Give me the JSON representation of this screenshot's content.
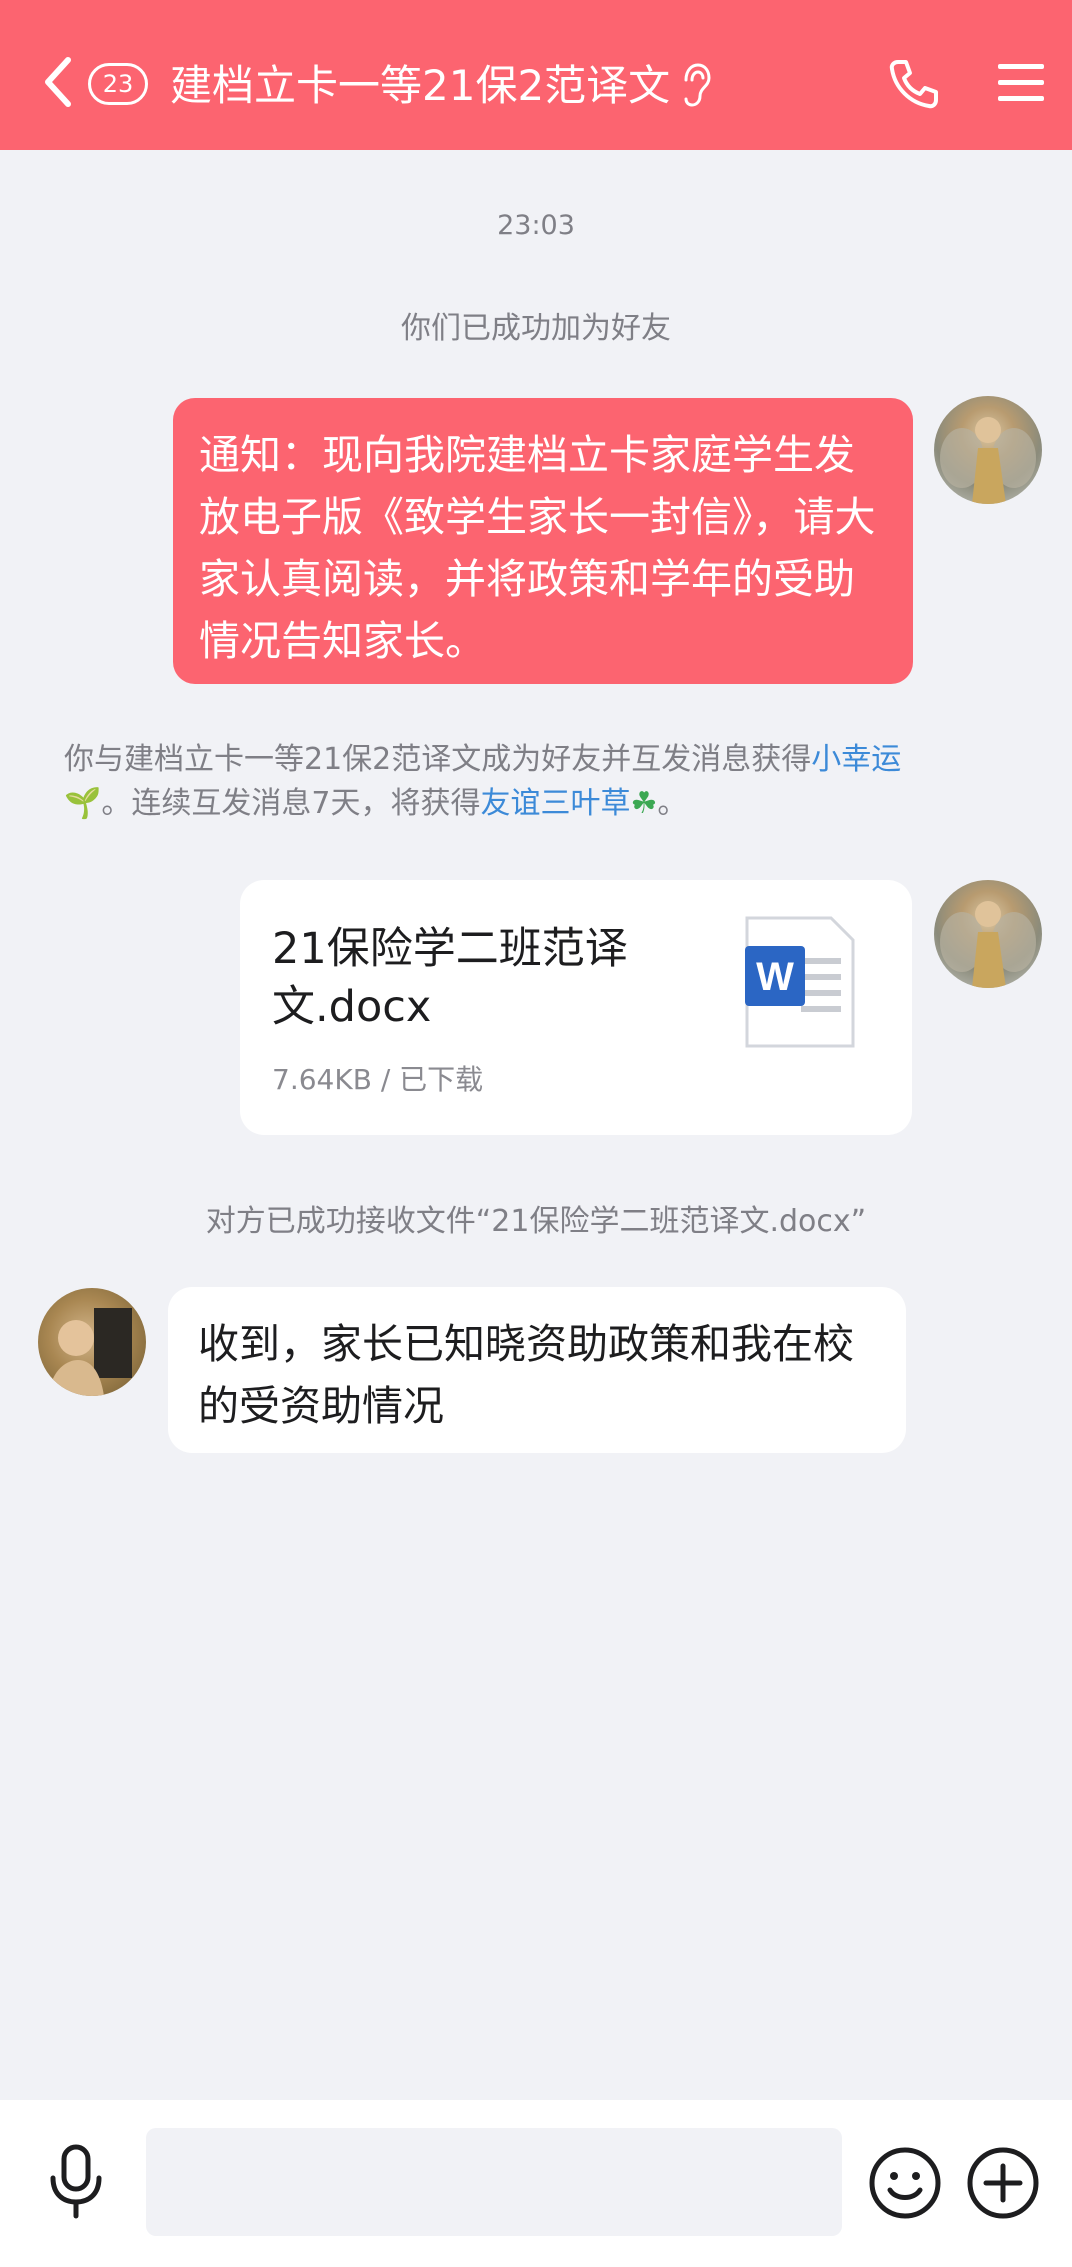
{
  "header": {
    "unread_count": "23",
    "title": "建档立卡一等21保2范译文"
  },
  "chat": {
    "time": "23:03",
    "friend_notice": "你们已成功加为好友",
    "message_1": "通知：现向我院建档立卡家庭学生发放电子版《致学生家长一封信》，请大家认真阅读，并将政策和学年的受助情况告知家长。",
    "friendship_notice": {
      "prefix": "你与建档立卡一等21保2范译文成为好友并互发消息获得",
      "link_1": "小幸运",
      "link_1_icon": "🌱",
      "middle": "。连续互发消息7天，将获得",
      "link_2": "友谊三叶草",
      "link_2_icon": "☘",
      "suffix": "。"
    },
    "file": {
      "name": "21保险学二班范译文.docx",
      "meta": "7.64KB / 已下载",
      "icon_letter": "W"
    },
    "file_received_notice": "对方已成功接收文件“21保险学二班范译文.docx”",
    "message_2": "收到，家长已知晓资助政策和我在校的受资助情况"
  },
  "input": {
    "placeholder": ""
  },
  "colors": {
    "accent": "#fc6470",
    "link": "#3c8ad8",
    "background": "#f1f2f6",
    "word_blue": "#2b66c4"
  },
  "icons": [
    "back-arrow-icon",
    "ear-icon",
    "phone-icon",
    "menu-icon",
    "word-file-icon",
    "mic-icon",
    "emoji-icon",
    "plus-icon"
  ]
}
